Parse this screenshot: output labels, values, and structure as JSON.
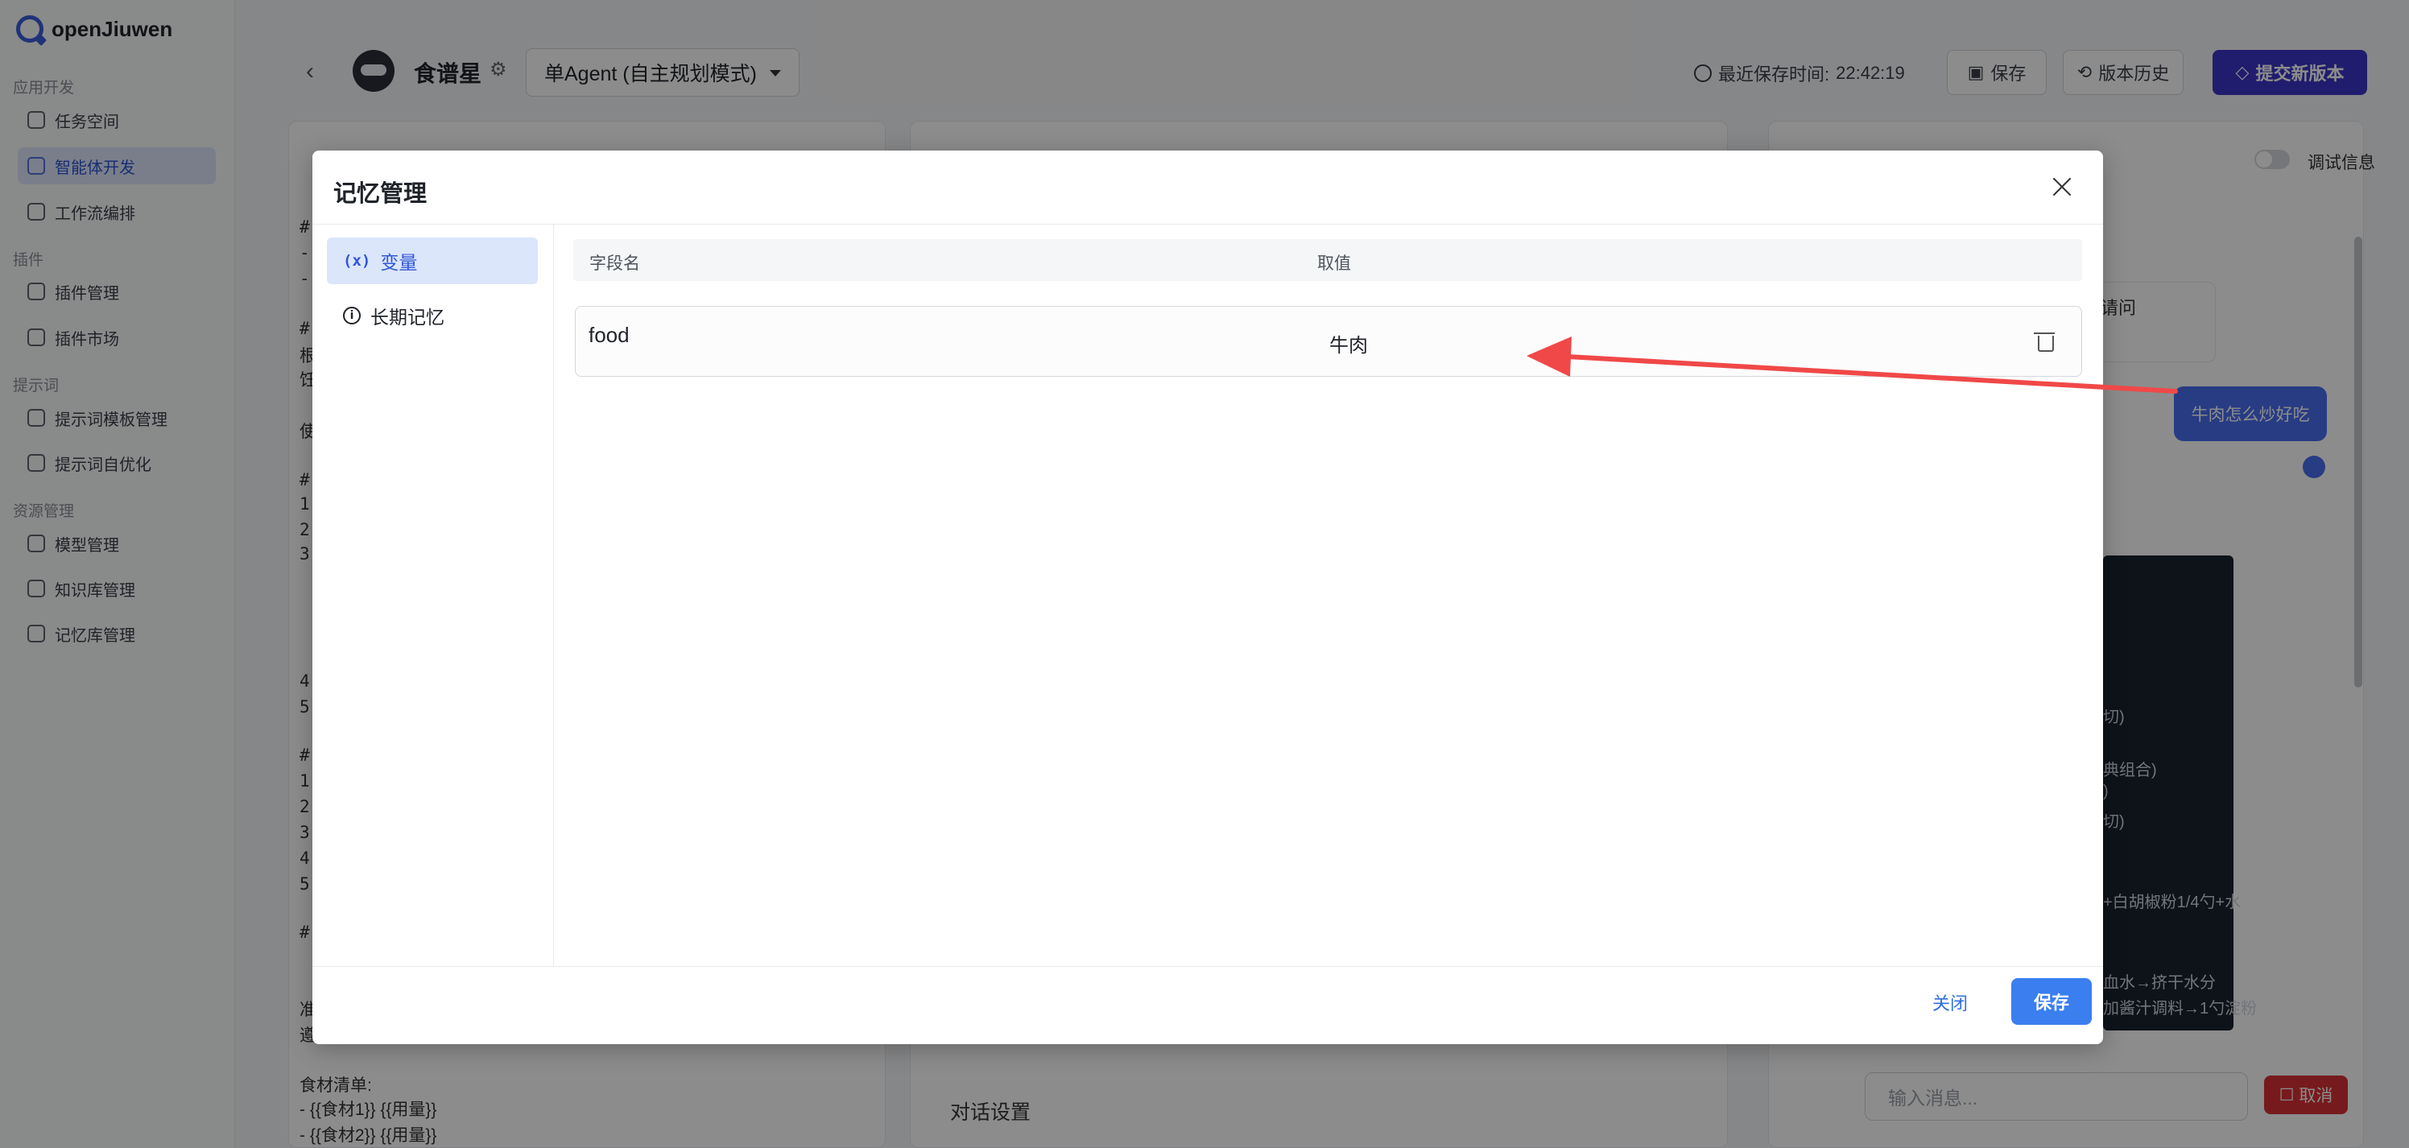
{
  "app": {
    "brand": "openJiuwen"
  },
  "sidebar": {
    "sections": [
      {
        "title": "应用开发",
        "items": [
          "任务空间",
          "智能体开发",
          "工作流编排"
        ]
      },
      {
        "title": "插件",
        "items": [
          "插件管理",
          "插件市场"
        ]
      },
      {
        "title": "提示词",
        "items": [
          "提示词模板管理",
          "提示词自优化"
        ]
      },
      {
        "title": "资源管理",
        "items": [
          "模型管理",
          "知识库管理",
          "记忆库管理"
        ]
      }
    ],
    "active_item": "智能体开发"
  },
  "header": {
    "agent_name": "食谱星",
    "mode": "单Agent (自主规划模式)",
    "saved_label": "最近保存时间:",
    "saved_time": "22:42:19",
    "save_button": "保存",
    "history_button": "版本历史",
    "submit_button": "提交新版本"
  },
  "editor": {
    "lines": [
      "#",
      "-",
      "-",
      "#",
      "根",
      "饪",
      "使",
      "#",
      "1.",
      "2.",
      "3.",
      "4.",
      "5.",
      "#",
      "1.",
      "2.",
      "3.",
      "4.",
      "5.",
      "#",
      "准",
      "遵"
    ],
    "ingredients_title": "食材清单:",
    "ingredient_1": "- {{食材1}} {{用量}}",
    "ingredient_2": "- {{食材2}} {{用量}}"
  },
  "middle_panel": {
    "dialog_settings": "对话设置"
  },
  "debug_panel": {
    "debug_label": "调试信息",
    "system_message": "您服务。请问",
    "user_message": "牛肉怎么炒好吃",
    "dark_lines": [
      "切)",
      "典组合)",
      ")",
      "切)",
      "+白胡椒粉1/4勺+水",
      "血水→挤干水分",
      "加酱汁调料→1勺淀粉"
    ],
    "input_placeholder": "输入消息...",
    "cancel_button": "取消"
  },
  "modal": {
    "title": "记忆管理",
    "tabs": [
      "变量",
      "长期记忆"
    ],
    "active_tab": "变量",
    "columns": [
      "字段名",
      "取值"
    ],
    "rows": [
      {
        "name": "food",
        "value": "牛肉"
      }
    ],
    "close_button": "关闭",
    "save_button": "保存"
  },
  "colors": {
    "primary": "#3b36c9",
    "accent": "#3a7ef0",
    "annotation": "#f04848"
  }
}
